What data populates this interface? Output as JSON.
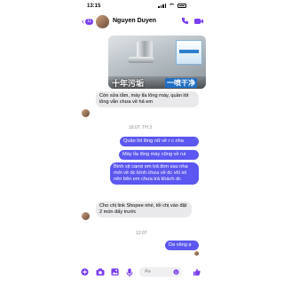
{
  "status_bar": {
    "time": "13:15"
  },
  "header": {
    "back_count": "11",
    "contact_name": "Nguyen Duyen",
    "call_icon": "phone-icon",
    "video_icon": "video-call-icon"
  },
  "shared_image": {
    "caption": "十年污垢",
    "caption_accent": "一喷干净"
  },
  "messages": [
    {
      "direction": "incoming",
      "text": "Còn sửa tắm, máy tỉa lông mày, quần lót lông vẫn chưa về hả em"
    },
    {
      "direction": "timestamp",
      "text": "16:07, TH 3"
    },
    {
      "direction": "outgoing",
      "text": "Quần lót lông nữ về r c nha"
    },
    {
      "direction": "outgoing",
      "text": "Máy tỉa lông mày cũng về rui"
    },
    {
      "direction": "outgoing",
      "text": "Bình xịt canxi em trả đơn sau nha mới về dc bình chưa về dc vôi xit nên bên em chưa trả khách dc"
    },
    {
      "direction": "incoming",
      "text": "Cho chị link Shopee nhé, tối chị vào đặt 2 món đấy trước"
    },
    {
      "direction": "timestamp",
      "text": "12:07"
    },
    {
      "direction": "outgoing",
      "text": "Da vâng ạ"
    }
  ],
  "composer": {
    "placeholder": "Aa",
    "icons": [
      "plus-icon",
      "camera-icon",
      "image-icon",
      "microphone-icon",
      "emoji-icon",
      "like-icon"
    ]
  },
  "colors": {
    "accent": "#7b3cf2",
    "outgoing_bubble": "#5b57f0",
    "incoming_bubble": "#e9e9eb"
  }
}
